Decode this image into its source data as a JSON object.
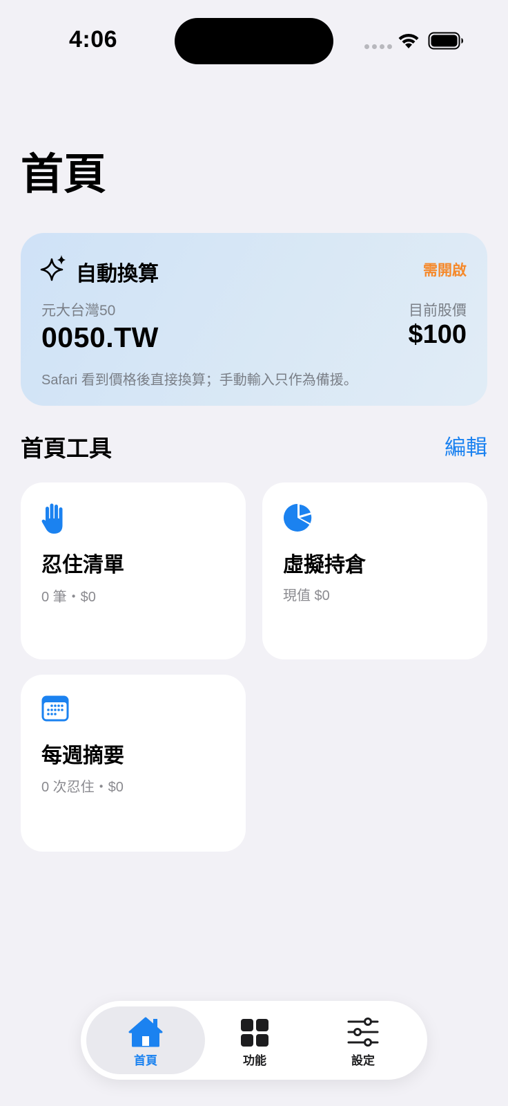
{
  "status": {
    "time": "4:06"
  },
  "page": {
    "title": "首頁"
  },
  "auto_card": {
    "title": "自動換算",
    "badge": "需開啟",
    "stock_name": "元大台灣50",
    "price_label": "目前股價",
    "stock_code": "0050.TW",
    "price": "$100",
    "note": "Safari 看到價格後直接換算；手動輸入只作為備援。"
  },
  "tools": {
    "section_title": "首頁工具",
    "edit_label": "編輯",
    "items": [
      {
        "title": "忍住清單",
        "subtitle": "0 筆・$0",
        "icon": "hand-raised-icon"
      },
      {
        "title": "虛擬持倉",
        "subtitle": "現值 $0",
        "icon": "pie-chart-icon"
      },
      {
        "title": "每週摘要",
        "subtitle": "0 次忍住・$0",
        "icon": "calendar-icon"
      }
    ]
  },
  "tab_bar": {
    "tabs": [
      {
        "label": "首頁",
        "icon": "house-icon",
        "selected": true
      },
      {
        "label": "功能",
        "icon": "grid-icon",
        "selected": false
      },
      {
        "label": "設定",
        "icon": "sliders-icon",
        "selected": false
      }
    ]
  },
  "colors": {
    "accent": "#1b82f0",
    "badge": "#f5892b",
    "background": "#f2f1f6"
  }
}
